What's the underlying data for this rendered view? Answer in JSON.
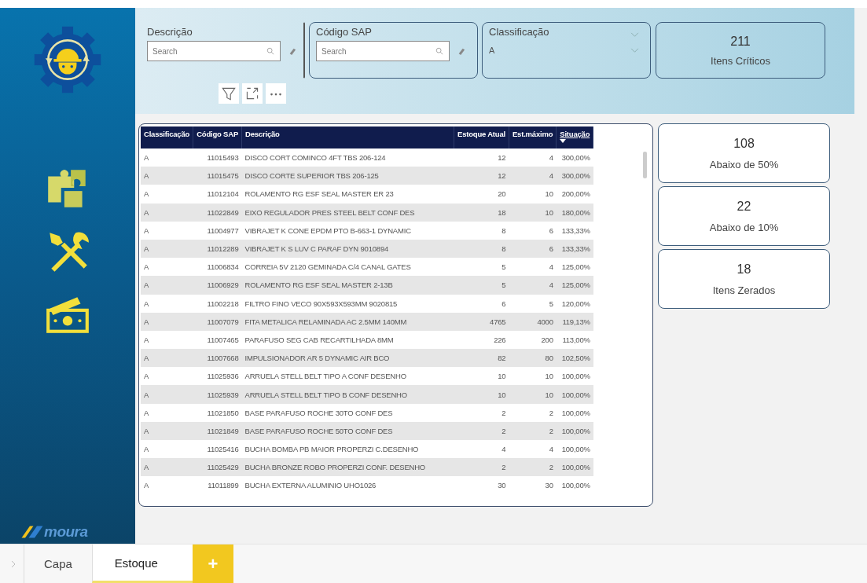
{
  "brand": {
    "logo_text": "moura"
  },
  "filters": [
    {
      "kind": "search",
      "label": "Descrição",
      "placeholder": "Search"
    },
    {
      "kind": "search",
      "label": "Código SAP",
      "placeholder": "Search"
    },
    {
      "kind": "dropdown",
      "label": "Classificação",
      "value": "A"
    }
  ],
  "top_kpi": {
    "value": "211",
    "label": "Itens Críticos"
  },
  "side_kpis": [
    {
      "value": "108",
      "label": "Abaixo de 50%"
    },
    {
      "value": "22",
      "label": "Abaixo de 10%"
    },
    {
      "value": "18",
      "label": "Itens Zerados"
    }
  ],
  "table": {
    "columns": [
      {
        "label": "Classificação",
        "sorted": false
      },
      {
        "label": "Código SAP",
        "sorted": false
      },
      {
        "label": "Descrição",
        "sorted": false
      },
      {
        "label": "Estoque Atual",
        "sorted": false
      },
      {
        "label": "Est.máximo",
        "sorted": false
      },
      {
        "label": "Situação",
        "sorted": true
      }
    ],
    "rows": [
      [
        "A",
        "11015493",
        "DISCO CORT COMINCO 4FT TBS 206-124",
        "12",
        "4",
        "300,00%"
      ],
      [
        "A",
        "11015475",
        "DISCO CORTE SUPERIOR TBS 206-125",
        "12",
        "4",
        "300,00%"
      ],
      [
        "A",
        "11012104",
        "ROLAMENTO RG ESF SEAL MASTER ER 23",
        "20",
        "10",
        "200,00%"
      ],
      [
        "A",
        "11022849",
        "EIXO REGULADOR PRES STEEL BELT CONF DES",
        "18",
        "10",
        "180,00%"
      ],
      [
        "A",
        "11004977",
        "VIBRAJET K CONE EPDM PTO B-663-1 DYNAMIC",
        "8",
        "6",
        "133,33%"
      ],
      [
        "A",
        "11012289",
        "VIBRAJET K S LUV C PARAF DYN 9010894",
        "8",
        "6",
        "133,33%"
      ],
      [
        "A",
        "11006834",
        "CORREIA 5V 2120 GEMINADA C/4 CANAL GATES",
        "5",
        "4",
        "125,00%"
      ],
      [
        "A",
        "11006929",
        "ROLAMENTO RG ESF SEAL MASTER 2-13B",
        "5",
        "4",
        "125,00%"
      ],
      [
        "A",
        "11002218",
        "FILTRO FINO VECO 90X593X593MM 9020815",
        "6",
        "5",
        "120,00%"
      ],
      [
        "A",
        "11007079",
        "FITA METALICA RELAMINADA AC 2.5MM 140MM",
        "4765",
        "4000",
        "119,13%"
      ],
      [
        "A",
        "11007465",
        "PARAFUSO SEG CAB RECARTILHADA 8MM",
        "226",
        "200",
        "113,00%"
      ],
      [
        "A",
        "11007668",
        "IMPULSIONADOR AR 5 DYNAMIC AIR BCO",
        "82",
        "80",
        "102,50%"
      ],
      [
        "A",
        "11025936",
        "ARRUELA STELL BELT TIPO A CONF DESENHO",
        "10",
        "10",
        "100,00%"
      ],
      [
        "A",
        "11025939",
        "ARRUELA STELL BELT TIPO B CONF DESENHO",
        "10",
        "10",
        "100,00%"
      ],
      [
        "A",
        "11021850",
        "BASE PARAFUSO ROCHE 30TO CONF DES",
        "2",
        "2",
        "100,00%"
      ],
      [
        "A",
        "11021849",
        "BASE PARAFUSO ROCHE 50TO CONF DES",
        "2",
        "2",
        "100,00%"
      ],
      [
        "A",
        "11025416",
        "BUCHA BOMBA PB MAIOR PROPERZI C.DESENHO",
        "4",
        "4",
        "100,00%"
      ],
      [
        "A",
        "11025429",
        "BUCHA BRONZE ROBO PROPERZI CONF. DESENHO",
        "2",
        "2",
        "100,00%"
      ],
      [
        "A",
        "11011899",
        "BUCHA EXTERNA ALUMINIO UHO1026",
        "30",
        "30",
        "100,00%"
      ]
    ]
  },
  "tabs": [
    {
      "label": "Capa",
      "selected": false
    },
    {
      "label": "Estoque",
      "selected": true
    }
  ],
  "add_tab": "+"
}
